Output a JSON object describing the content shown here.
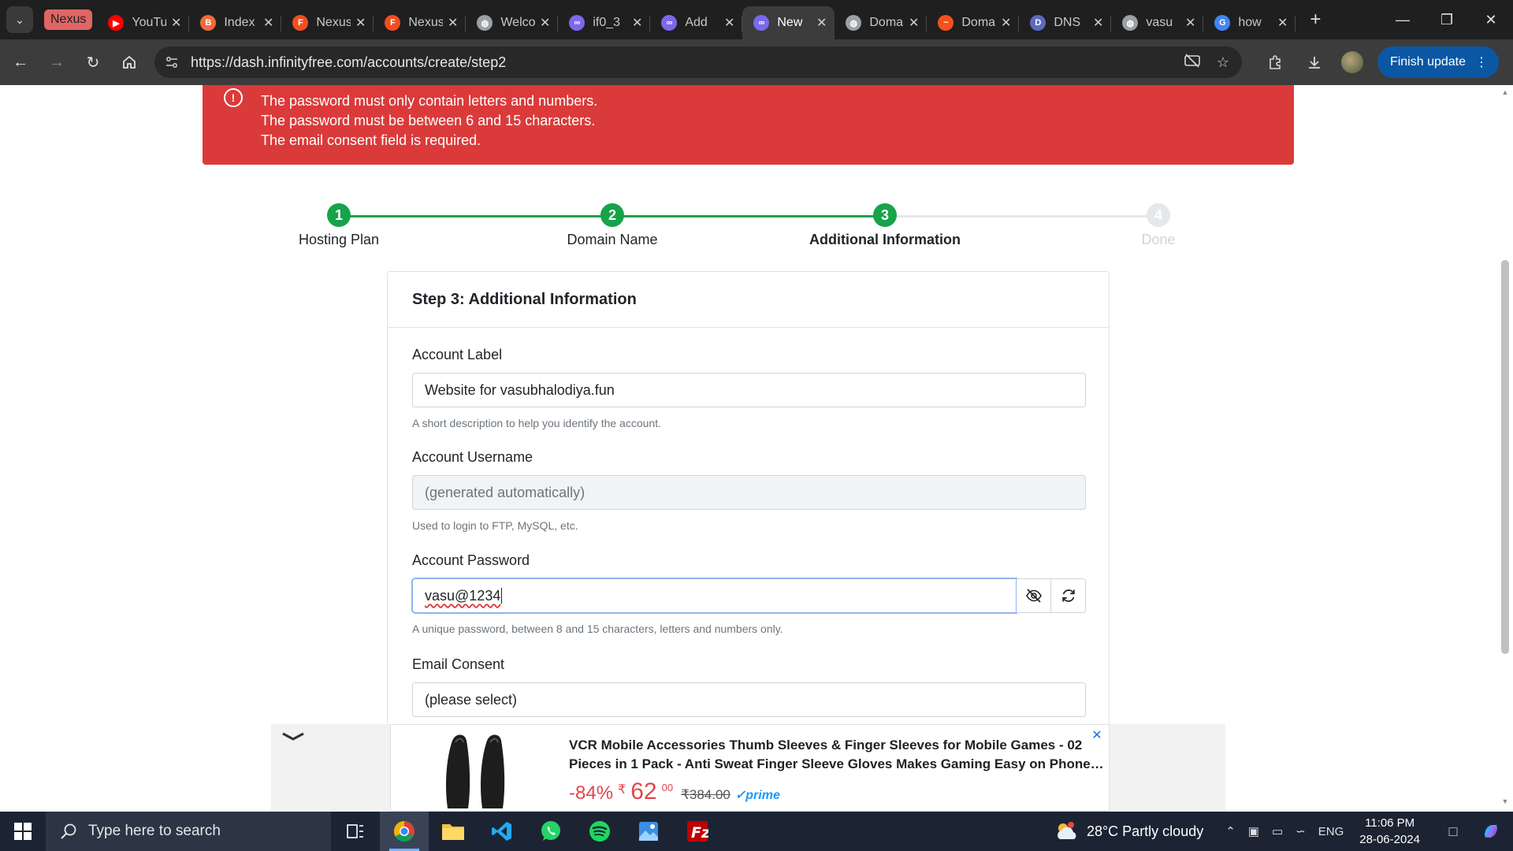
{
  "browser": {
    "tab_group_label": "Nexus",
    "tabs": [
      {
        "title": "YouTube",
        "favicon": "youtube-icon",
        "color": "#ff0000",
        "active": false
      },
      {
        "title": "Index",
        "favicon": "bolt-icon",
        "color": "#f26b3a",
        "active": false
      },
      {
        "title": "Nexus",
        "favicon": "figma-icon",
        "color": "#f24e1e",
        "active": false
      },
      {
        "title": "Nexus",
        "favicon": "figma-icon",
        "color": "#f24e1e",
        "active": false
      },
      {
        "title": "Welcome",
        "favicon": "globe-icon",
        "color": "#9aa0a6",
        "active": false
      },
      {
        "title": "if0_3",
        "favicon": "infinity-icon",
        "color": "#7b68ee",
        "active": false
      },
      {
        "title": "Add",
        "favicon": "infinity-icon",
        "color": "#7b68ee",
        "active": false
      },
      {
        "title": "New",
        "favicon": "infinity-icon",
        "color": "#7b68ee",
        "active": true
      },
      {
        "title": "Domain",
        "favicon": "globe-icon",
        "color": "#9aa0a6",
        "active": false
      },
      {
        "title": "Domain",
        "favicon": "wave-icon",
        "color": "#f4511e",
        "active": false
      },
      {
        "title": "DNS",
        "favicon": "dns-icon",
        "color": "#5c6bc0",
        "active": false
      },
      {
        "title": "vasu",
        "favicon": "globe-icon",
        "color": "#9aa0a6",
        "active": false
      },
      {
        "title": "how",
        "favicon": "google-icon",
        "color": "#4285f4",
        "active": false
      }
    ],
    "url": "https://dash.infinityfree.com/accounts/create/step2",
    "finish_update_label": "Finish update"
  },
  "alert": {
    "lines": [
      "The password must only contain letters and numbers.",
      "The password must be between 6 and 15 characters.",
      "The email consent field is required."
    ]
  },
  "stepper": {
    "steps": [
      {
        "number": "1",
        "label": "Hosting Plan",
        "state": "done"
      },
      {
        "number": "2",
        "label": "Domain Name",
        "state": "done"
      },
      {
        "number": "3",
        "label": "Additional Information",
        "state": "current"
      },
      {
        "number": "4",
        "label": "Done",
        "state": "todo"
      }
    ],
    "colors": {
      "done": "#16a34a",
      "todo": "#e5e7eb"
    }
  },
  "form": {
    "heading": "Step 3: Additional Information",
    "account_label": {
      "label": "Account Label",
      "value": "Website for vasubhalodiya.fun",
      "help": "A short description to help you identify the account."
    },
    "account_username": {
      "label": "Account Username",
      "placeholder": "(generated automatically)",
      "help": "Used to login to FTP, MySQL, etc."
    },
    "account_password": {
      "label": "Account Password",
      "value": "vasu@1234",
      "help": "A unique password, between 8 and 15 characters, letters and numbers only."
    },
    "email_consent": {
      "label": "Email Consent",
      "selected": "(please select)"
    }
  },
  "ad": {
    "title_line1": "VCR Mobile Accessories Thumb Sleeves & Finger Sleeves for Mobile Games - 02",
    "title_line2": "Pieces in 1 Pack - Anti Sweat Finger Sleeve Gloves Makes Gaming Easy on Phone…",
    "discount": "-84%",
    "currency": "₹",
    "price": "62",
    "price_cents": "00",
    "old_price": "₹384.00",
    "prime": "✓prime"
  },
  "taskbar": {
    "search_placeholder": "Type here to search",
    "weather": "28°C  Partly cloudy",
    "language": "ENG",
    "time": "11:06 PM",
    "date": "28-06-2024"
  }
}
